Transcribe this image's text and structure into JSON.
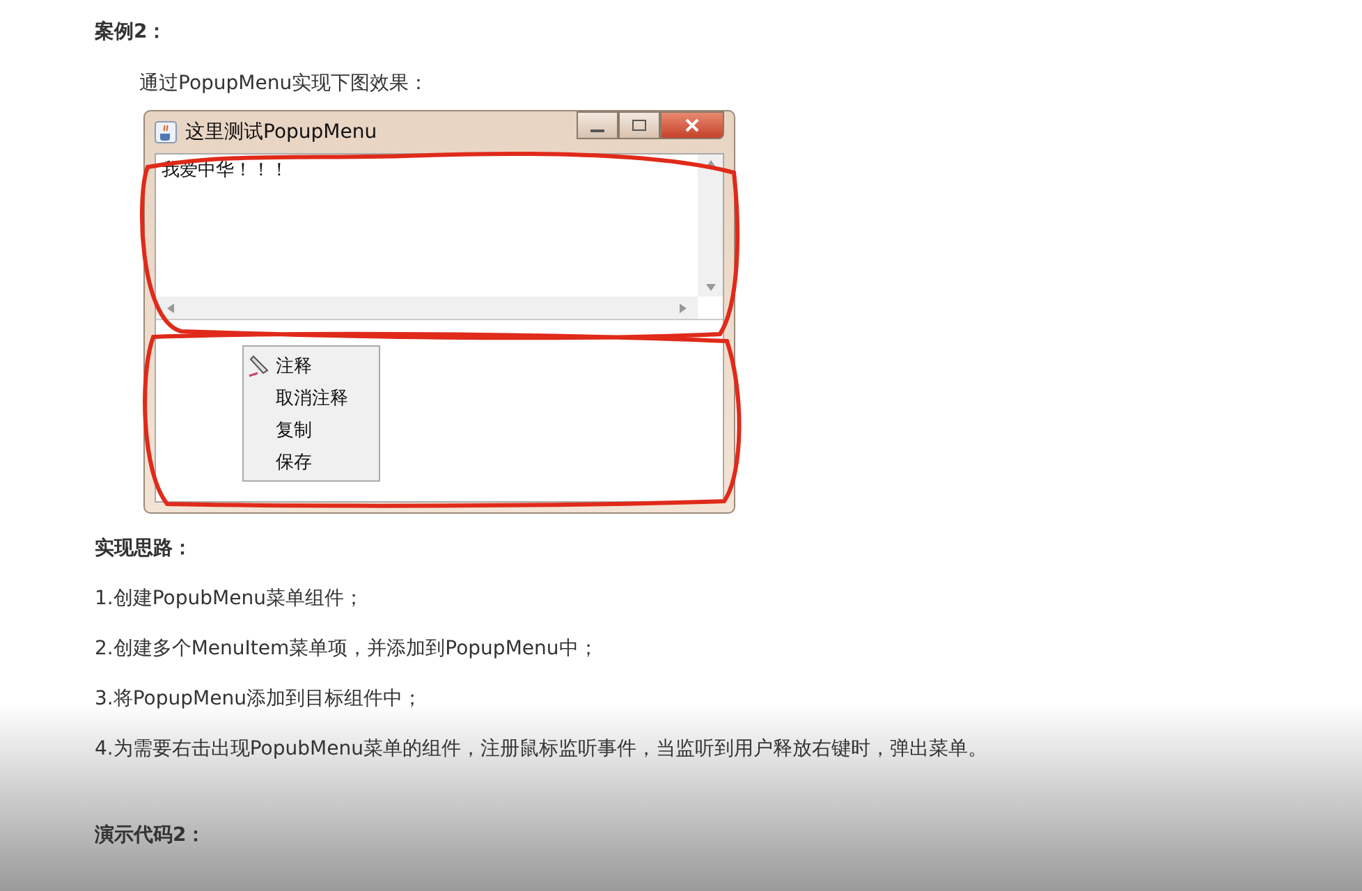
{
  "heading": "案例2：",
  "intro": "通过PopupMenu实现下图效果：",
  "window": {
    "title": "这里测试PopupMenu",
    "text_area": {
      "value": "我爱中华！！！"
    },
    "popup_menu": [
      {
        "label": "注释",
        "kind": "icon"
      },
      {
        "label": "取消注释",
        "kind": "plain"
      },
      {
        "label": "复制",
        "kind": "plain"
      },
      {
        "label": "保存",
        "kind": "plain"
      }
    ]
  },
  "steps_heading": "实现思路：",
  "steps": [
    "1.创建PopubMenu菜单组件；",
    "2.创建多个MenuItem菜单项，并添加到PopupMenu中；",
    "3.将PopupMenu添加到目标组件中；",
    "4.为需要右击出现PopubMenu菜单的组件，注册鼠标监听事件，当监听到用户释放右键时，弹出菜单。"
  ],
  "code_heading": "演示代码2："
}
